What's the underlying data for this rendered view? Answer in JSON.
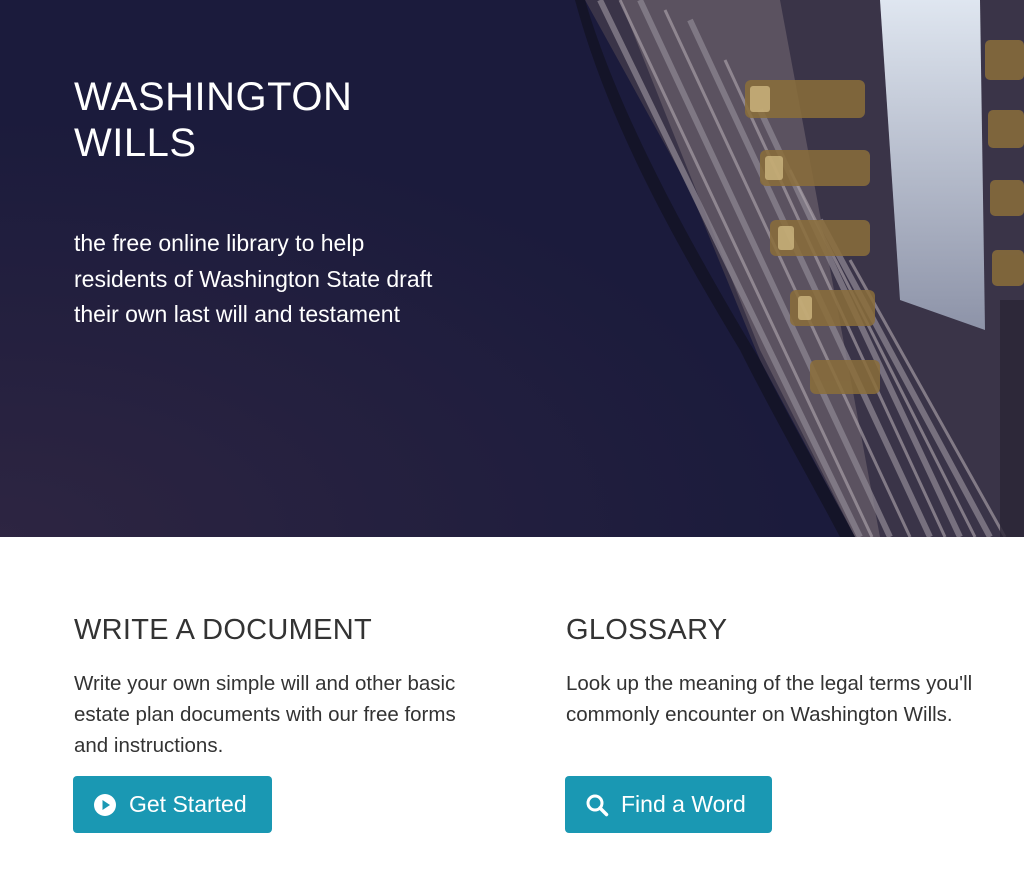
{
  "hero": {
    "title_line1": "WASHINGTON",
    "title_line2": "WILLS",
    "tagline_line1": "the free online library to help",
    "tagline_line2": "residents of Washington State draft",
    "tagline_line3": "their own last will and testament",
    "background_color": "#1b1b3c",
    "background_image": "books-on-shelf-photo"
  },
  "write_section": {
    "heading": "WRITE A DOCUMENT",
    "description_line1": "Write your own simple will and other basic",
    "description_line2": "estate plan documents with our free forms",
    "description_line3": "and instructions.",
    "button_label": "Get Started",
    "button_icon": "play-circle-icon"
  },
  "glossary_section": {
    "heading": "GLOSSARY",
    "description_line1": "Look up the meaning of the legal terms you'll",
    "description_line2": "commonly encounter on Washington Wills.",
    "button_label": "Find a Word",
    "button_icon": "search-icon"
  },
  "colors": {
    "button": "#1a98b3",
    "hero": "#1b1b3c",
    "text": "#333333"
  }
}
